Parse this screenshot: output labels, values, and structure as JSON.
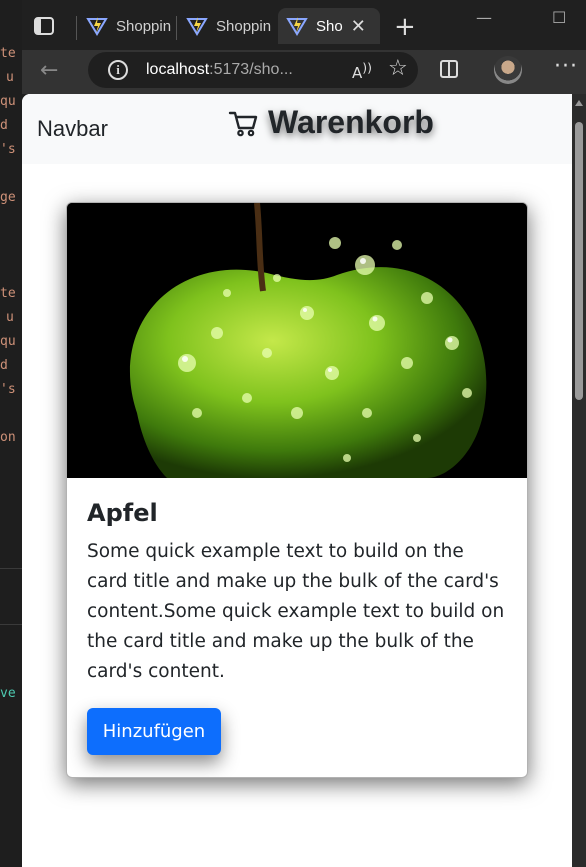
{
  "browser": {
    "tabs": [
      {
        "label": "Shoppin",
        "active": false
      },
      {
        "label": "Shoppin",
        "active": false
      },
      {
        "label": "Sho",
        "active": true
      }
    ],
    "url_host": "localhost",
    "url_rest": ":5173/sho...",
    "icons": [
      "tab-actions-icon",
      "vite-icon",
      "close-icon",
      "new-tab-icon",
      "back-icon",
      "info-icon",
      "read-aloud-icon",
      "favorite-star-icon",
      "split-screen-icon",
      "profile-avatar",
      "more-icon"
    ]
  },
  "page": {
    "navbar": {
      "brand": "Navbar",
      "cart_title": "Warenkorb"
    },
    "card": {
      "title": "Apfel",
      "text": "Some quick example text to build on the card title and make up the bulk of the card's content.Some quick example text to build on the card title and make up the bulk of the card's content.",
      "button": "Hinzufügen",
      "image": "green apple with water droplets",
      "button_color": "#0d6efd"
    }
  }
}
